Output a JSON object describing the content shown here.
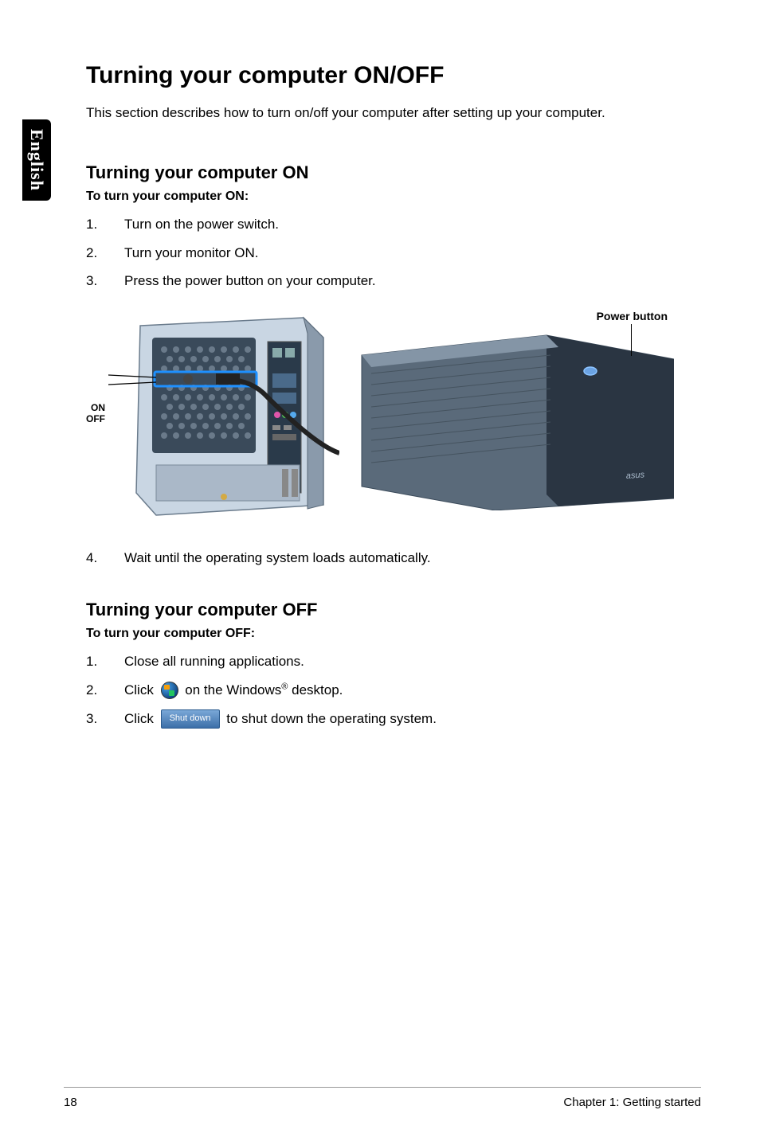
{
  "language_tab": "English",
  "title": "Turning your computer ON/OFF",
  "intro": "This section describes how to turn on/off your computer after setting up your computer.",
  "section_on": {
    "heading": "Turning your computer ON",
    "subhead": "To turn your computer ON:",
    "steps": [
      {
        "num": "1.",
        "text": "Turn on the power switch."
      },
      {
        "num": "2.",
        "text": "Turn your monitor ON."
      },
      {
        "num": "3.",
        "text": "Press the power button on your computer."
      }
    ],
    "step4": {
      "num": "4.",
      "text": "Wait until the operating system loads automatically."
    }
  },
  "diagram": {
    "on_label": "ON",
    "off_label": "OFF",
    "power_button_label": "Power button"
  },
  "section_off": {
    "heading": "Turning your computer OFF",
    "subhead": "To turn your computer OFF:",
    "steps": [
      {
        "num": "1.",
        "text": "Close all running applications."
      },
      {
        "num": "2.",
        "prefix": "Click ",
        "suffix_before": " on the Windows",
        "regmark": "®",
        "suffix_after": " desktop."
      },
      {
        "num": "3.",
        "prefix": "Click ",
        "btn_text": "Shut down",
        "suffix": " to shut down the operating system."
      }
    ]
  },
  "footer": {
    "page": "18",
    "chapter": "Chapter 1: Getting started"
  }
}
